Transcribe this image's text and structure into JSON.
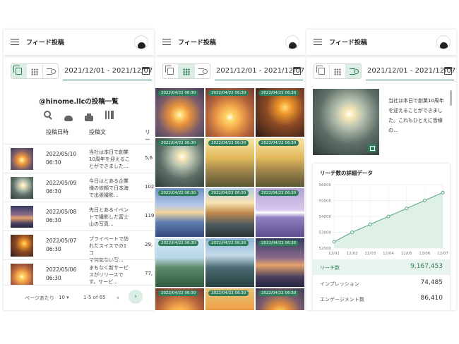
{
  "app": {
    "title": "フィード投稿",
    "date_range": "2021/12/01 - 2021/12/07"
  },
  "list_view": {
    "title": "@hinome.llcの投稿一覧",
    "columns": [
      "投稿日時",
      "投稿文",
      "リー"
    ],
    "rows": [
      {
        "date": "2022/05/10",
        "time": "06:30",
        "text": "当社は本日で創業10周年を迎えることができました。",
        "text_visible": "当社は本日で創業\n10周年を迎えるこ\nとができました...",
        "num": "5,6",
        "img": "sun1"
      },
      {
        "date": "2022/05/09",
        "time": "06:30",
        "text_visible": "今日はとある企業\n様の依頼で日本海\nで出張撮影...",
        "num": "102",
        "img": "hand"
      },
      {
        "date": "2022/05/08",
        "time": "06:30",
        "text_visible": "先日とあるイベン\nトで撮影した富士\n山の写真...",
        "num": "119",
        "img": "dusk"
      },
      {
        "date": "2022/05/07",
        "time": "06:30",
        "text_visible": "プライベートで訪\nれたスイスでの1コ\nマ何気ない写...",
        "num": "29,",
        "img": "sun3"
      },
      {
        "date": "2022/05/06",
        "time": "06:30",
        "text_visible": "まもなく新サービ\nスがリリースで\nす。サービ...",
        "num": "77,",
        "img": "sun2"
      }
    ],
    "footer": {
      "rows_per_page_label": "ページあたり",
      "rows_per_page": "10",
      "range": "1-5 of 65",
      "prev": "‹",
      "next": "›"
    }
  },
  "grid_view": {
    "tag": "2022/04/22 06:30",
    "cells": [
      "sun1",
      "sun2",
      "sun3",
      "hand",
      "grass",
      "grass",
      "lake",
      "mtn",
      "purp",
      "plant",
      "rock",
      "dusk",
      "sun2",
      "sunset4",
      "sun1"
    ]
  },
  "detail_view": {
    "caption": "当社は本日で創業10周年を迎えることができました。これもひとえに皆様の...",
    "chart_title": "リーチ数の詳細データ",
    "stats": [
      {
        "label": "リーチ数",
        "value": "9,167,453"
      },
      {
        "label": "インプレッション",
        "value": "74,485"
      },
      {
        "label": "エンゲージメント数",
        "value": "86,410"
      }
    ]
  },
  "colors": {
    "accent": "#2e7d5b",
    "accent_light": "#dbeee3"
  },
  "chart_data": {
    "type": "area",
    "title": "リーチ数の詳細データ",
    "categories": [
      "12/01",
      "12/02",
      "12/03",
      "12/04",
      "12/05",
      "12/06",
      "12/07"
    ],
    "values": [
      52400,
      53000,
      53500,
      54000,
      54500,
      55000,
      55500
    ],
    "yticks": [
      "52000",
      "53000",
      "54000",
      "55000",
      "56000"
    ],
    "ylim": [
      52000,
      56000
    ],
    "grid": true
  }
}
